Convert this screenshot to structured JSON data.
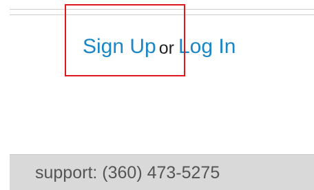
{
  "auth": {
    "signup_label": "Sign Up",
    "or_label": "or",
    "login_label": "Log In"
  },
  "footer": {
    "support_text": "support: (360) 473-5275"
  },
  "colors": {
    "link": "#1a86c5",
    "highlight": "#e0181e",
    "footer_bg": "#d9d9d9"
  }
}
